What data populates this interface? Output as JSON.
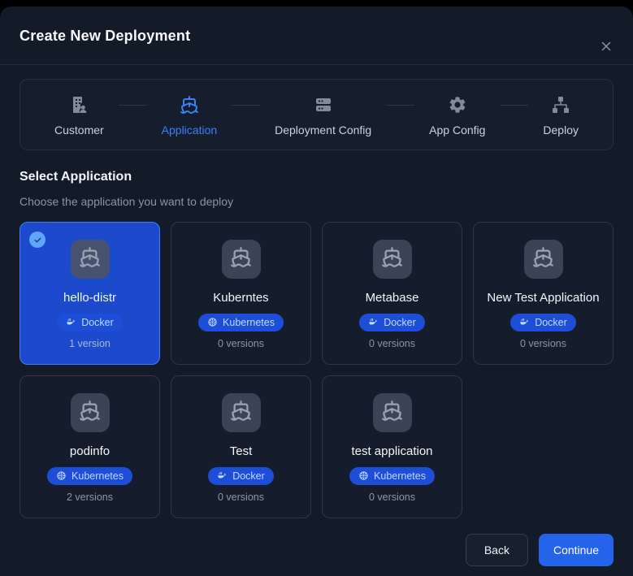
{
  "modal": {
    "title": "Create New Deployment",
    "close_icon": "x-icon"
  },
  "stepper": {
    "steps": [
      {
        "label": "Customer",
        "icon": "building-user-icon",
        "active": false
      },
      {
        "label": "Application",
        "icon": "ship-icon",
        "active": true
      },
      {
        "label": "Deployment Config",
        "icon": "server-icon",
        "active": false
      },
      {
        "label": "App Config",
        "icon": "gear-icon",
        "active": false
      },
      {
        "label": "Deploy",
        "icon": "network-icon",
        "active": false
      }
    ]
  },
  "section": {
    "title": "Select Application",
    "subtitle": "Choose the application you want to deploy"
  },
  "applications": [
    {
      "name": "hello-distr",
      "type": "Docker",
      "versions": "1 version",
      "selected": true
    },
    {
      "name": "Kuberntes",
      "type": "Kubernetes",
      "versions": "0 versions",
      "selected": false
    },
    {
      "name": "Metabase",
      "type": "Docker",
      "versions": "0 versions",
      "selected": false
    },
    {
      "name": "New Test Application",
      "type": "Docker",
      "versions": "0 versions",
      "selected": false
    },
    {
      "name": "podinfo",
      "type": "Kubernetes",
      "versions": "2 versions",
      "selected": false
    },
    {
      "name": "Test",
      "type": "Docker",
      "versions": "0 versions",
      "selected": false
    },
    {
      "name": "test application",
      "type": "Kubernetes",
      "versions": "0 versions",
      "selected": false
    }
  ],
  "footer": {
    "back_label": "Back",
    "continue_label": "Continue"
  },
  "colors": {
    "accent": "#3b82f6",
    "modal_bg": "#131a28",
    "selected_card_bg": "#1d49cc",
    "badge_bg": "#1d4ed8",
    "badge_text": "#bfdbfe",
    "continue_button_bg": "#2563eb",
    "check_circle_bg": "#60a5fa"
  }
}
